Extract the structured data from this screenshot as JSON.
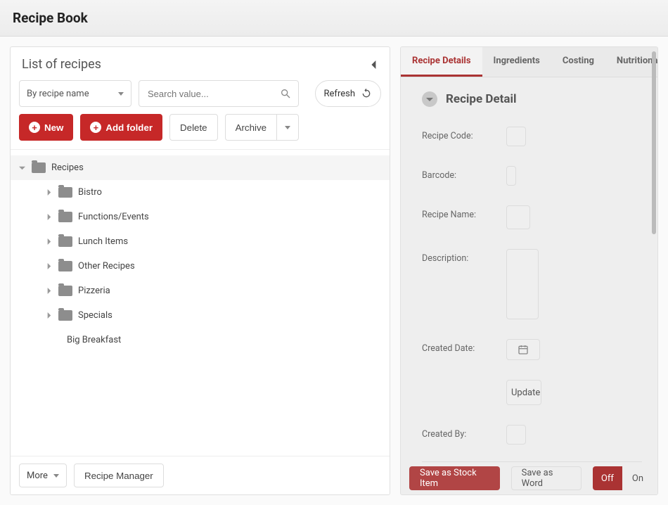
{
  "header": {
    "title": "Recipe Book"
  },
  "list": {
    "title": "List of recipes",
    "filter_label": "By recipe name",
    "search_placeholder": "Search value...",
    "refresh": "Refresh",
    "new": "New",
    "add_folder": "Add folder",
    "delete": "Delete",
    "archive": "Archive",
    "tree": {
      "root": "Recipes",
      "folders": [
        "Bistro",
        "Functions/Events",
        "Lunch Items",
        "Other Recipes",
        "Pizzeria",
        "Specials"
      ],
      "files": [
        "Big Breakfast"
      ]
    },
    "footer": {
      "more": "More",
      "manager": "Recipe Manager"
    }
  },
  "details": {
    "tabs": [
      "Recipe Details",
      "Ingredients",
      "Costing",
      "Nutritional I"
    ],
    "active_tab": 0,
    "section_title": "Recipe Detail",
    "fields": {
      "code": "Recipe Code:",
      "barcode": "Barcode:",
      "name": "Recipe Name:",
      "desc": "Description:",
      "created_date": "Created Date:",
      "update_btn": "Update",
      "created_by": "Created By:"
    },
    "bottom": {
      "save_stock": "Save as Stock Item",
      "save_word": "Save as Word",
      "off": "Off",
      "on": "On"
    }
  }
}
